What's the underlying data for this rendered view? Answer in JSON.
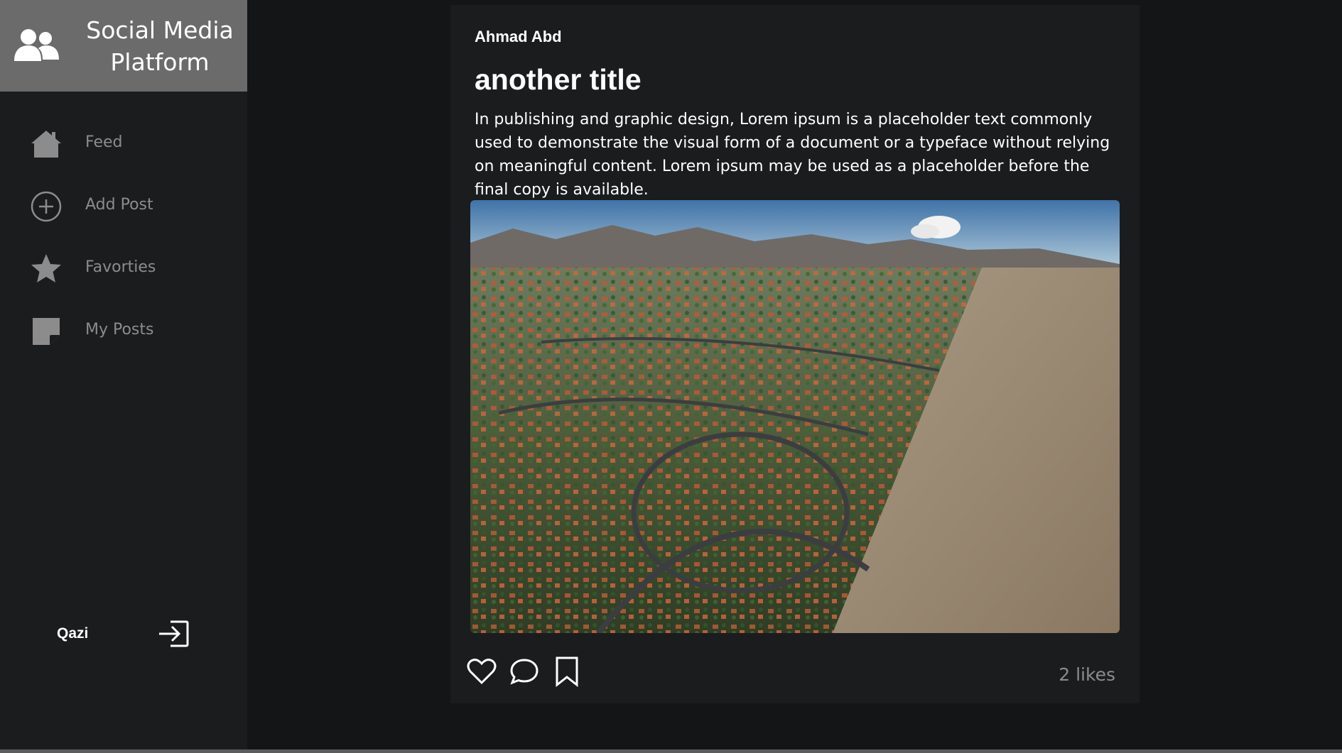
{
  "app": {
    "title": "Social Media Platform"
  },
  "sidebar": {
    "items": [
      {
        "label": "Feed",
        "icon": "home-icon"
      },
      {
        "label": "Add Post",
        "icon": "plus-circle-icon"
      },
      {
        "label": "Favorties",
        "icon": "star-icon"
      },
      {
        "label": "My Posts",
        "icon": "sticky-note-icon"
      }
    ],
    "user": {
      "name": "Qazi",
      "logout_icon": "logout-icon"
    }
  },
  "post": {
    "author": "Ahmad Abd",
    "title": "another title",
    "body": "In publishing and graphic design, Lorem ipsum is a placeholder text commonly used to demonstrate the visual form of a document or a typeface without relying on meaningful content. Lorem ipsum may be used as a placeholder before the final copy is available.",
    "likes": "2 likes",
    "actions": [
      "heart-icon",
      "comment-icon",
      "bookmark-icon"
    ]
  },
  "colors": {
    "background": "#141516",
    "panel": "#1b1c1e",
    "brand_header": "#6b6b6b",
    "muted_text": "#8c8c8c",
    "text": "#ffffff"
  }
}
